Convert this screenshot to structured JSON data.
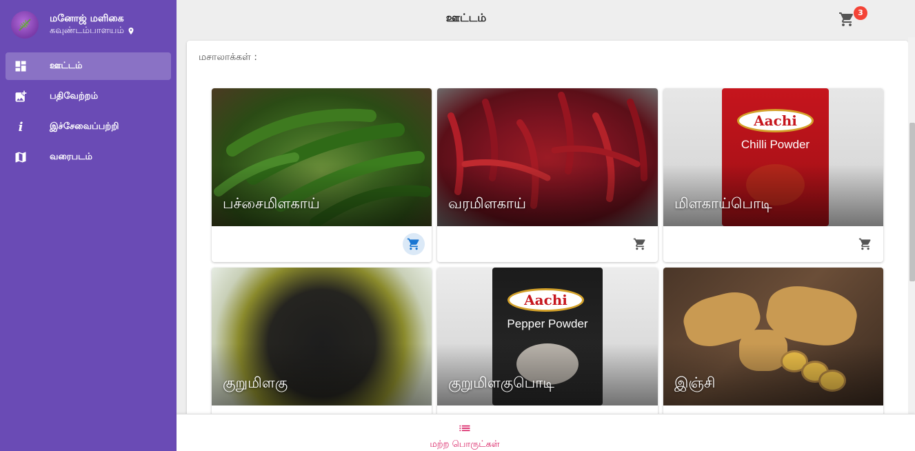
{
  "app": {
    "store_name": "மனோஜ் மளிகை",
    "location": "கவுண்டம்பாளயம்"
  },
  "sidebar": {
    "items": [
      {
        "label": "ஊட்டம்",
        "icon": "dashboard-icon",
        "active": true
      },
      {
        "label": "பதிவேற்றம்",
        "icon": "add-photo-icon",
        "active": false
      },
      {
        "label": "இச்சேவைப்பற்றி",
        "icon": "info-icon",
        "active": false
      },
      {
        "label": "வரைபடம்",
        "icon": "map-icon",
        "active": false
      }
    ]
  },
  "header": {
    "title": "ஊட்டம்",
    "cart_count": "3"
  },
  "main": {
    "section_title": "மசாலாக்கள் :",
    "products": [
      {
        "name": "பச்சைமிளகாய்"
      },
      {
        "name": "வரமிளகாய்"
      },
      {
        "name": "மிளகாய்பொடி"
      },
      {
        "name": "குறுமிளகு"
      },
      {
        "name": "குறுமிளகுபொடி"
      },
      {
        "name": "இஞ்சி"
      }
    ]
  },
  "packaging": {
    "brand": "Aachi",
    "chilli_label": "Chilli Powder",
    "pepper_label": "Pepper Powder"
  },
  "bottom_nav": {
    "label": "மற்ற பொருட்கள்"
  },
  "colors": {
    "sidebar": "#6a4bb5",
    "accent": "#d81b60",
    "badge": "#f44336",
    "cart_highlight": "#1976d2"
  }
}
